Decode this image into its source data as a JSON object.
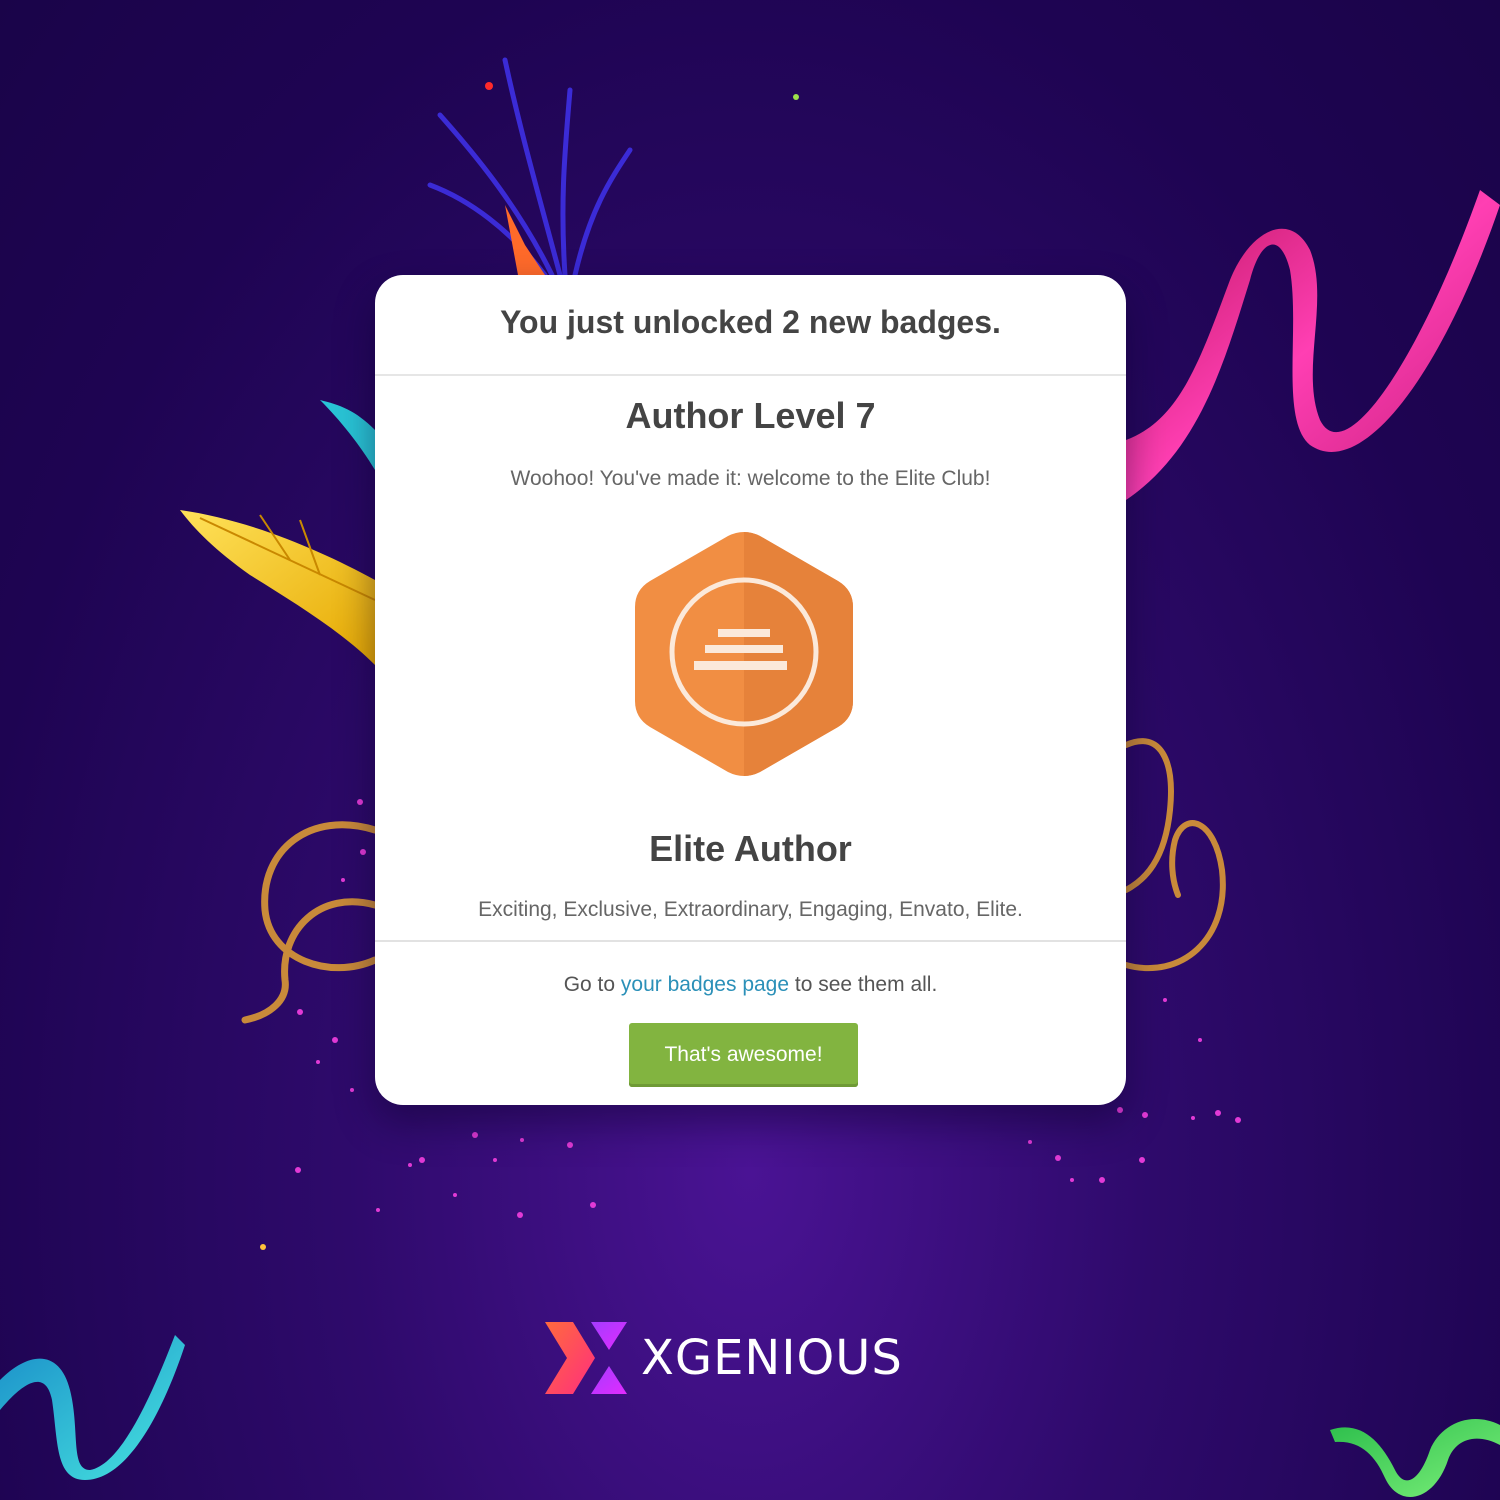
{
  "dialog": {
    "headline": "You just unlocked 2 new badges.",
    "badge_level_title": "Author Level 7",
    "badge_level_message": "Woohoo! You've made it: welcome to the Elite Club!",
    "badge_name": "Elite Author",
    "badge_description": "Exciting, Exclusive, Extraordinary, Engaging, Envato, Elite.",
    "footer_prefix": "Go to ",
    "footer_link": "your badges page",
    "footer_suffix": " to see them all.",
    "cta_label": "That's awesome!"
  },
  "brand": {
    "name": "XGENIOUS"
  },
  "colors": {
    "background": "#2a0866",
    "badge_orange": "#f18e43",
    "link": "#2b90b8",
    "cta_green": "#82b440",
    "text_dark": "#444444"
  }
}
